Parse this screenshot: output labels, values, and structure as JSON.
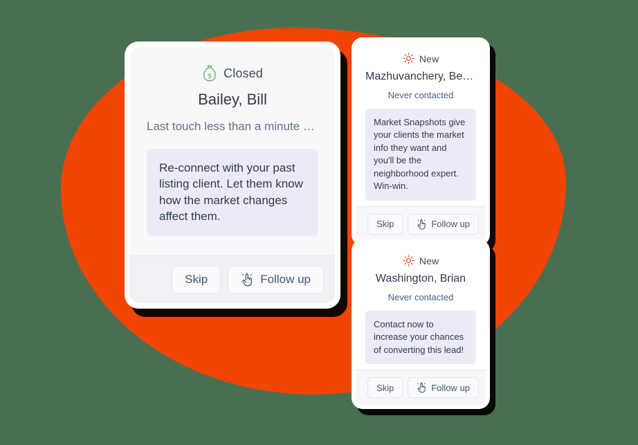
{
  "theme": {
    "background_color": "#4a6f50",
    "blob_color": "#f24405",
    "note_background": "#edeaf7",
    "status_closed_color": "#63b363",
    "status_new_color": "#e8462c",
    "link_text_color": "#3f6084"
  },
  "cards": [
    {
      "id": "bailey-bill",
      "status": {
        "icon": "money-bag-icon",
        "label": "Closed"
      },
      "lead_name": "Bailey, Bill",
      "sub_line": "Last touch less than a minute a…",
      "note": "Re-connect with your past listing client. Let them know how the market changes affect them.",
      "actions": {
        "skip_label": "Skip",
        "follow_up_label": "Follow up",
        "follow_up_icon": "tap-hand-icon"
      }
    },
    {
      "id": "mazhuvanchery-berli",
      "status": {
        "icon": "sun-sparkle-icon",
        "label": "New"
      },
      "lead_name": "Mazhuvanchery, Berli…",
      "sub_line": "Never contacted",
      "note": "Market Snapshots give your clients the market info they want and you'll be the neighborhood expert. Win-win.",
      "actions": {
        "skip_label": "Skip",
        "follow_up_label": "Follow up",
        "follow_up_icon": "tap-hand-icon"
      }
    },
    {
      "id": "washington-brian",
      "status": {
        "icon": "sun-sparkle-icon",
        "label": "New"
      },
      "lead_name": "Washington, Brian",
      "sub_line": "Never contacted",
      "note": "Contact now to increase your chances of converting this lead!",
      "actions": {
        "skip_label": "Skip",
        "follow_up_label": "Follow up",
        "follow_up_icon": "tap-hand-icon"
      }
    }
  ]
}
